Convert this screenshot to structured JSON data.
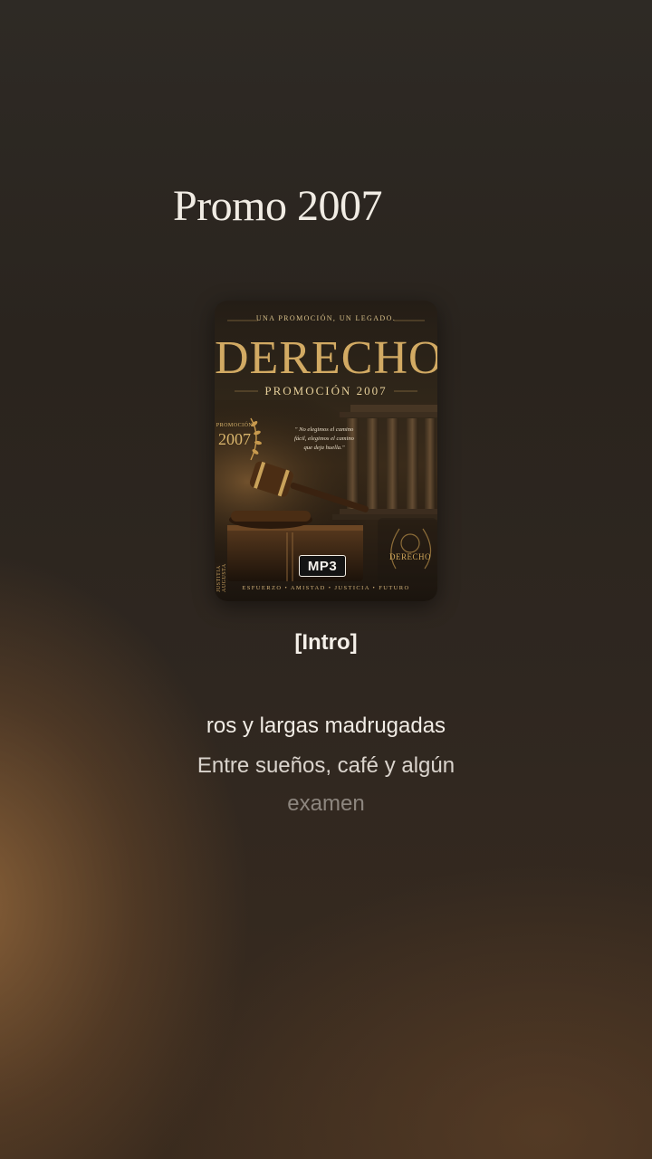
{
  "playlist_title": "Promo 2007",
  "cover": {
    "tagline": "UNA PROMOCIÓN, UN LEGADO.",
    "brand": "DERECHO",
    "subtitle": "PROMOCIÓN 2007",
    "side_label": "PROMOCIÓN",
    "side_year": "2007",
    "quote": "\" No elegimos el camino fácil, elegimos el camino que deja huella.\"",
    "seal_text": "DERECHO",
    "spine_text": "JUSTITIA AUGUSTA",
    "footer": "ESFUERZO • AMISTAD • JUSTICIA • FUTURO",
    "badge": "MP3"
  },
  "section_label": "[Intro]",
  "lyrics": [
    "ros y largas madrugadas",
    "Entre sueños, café y algún",
    "examen"
  ],
  "colors": {
    "gold": "#d2aa63",
    "text": "#f1ece5",
    "background_dark": "#2a241e",
    "background_warm": "#9a693c"
  }
}
